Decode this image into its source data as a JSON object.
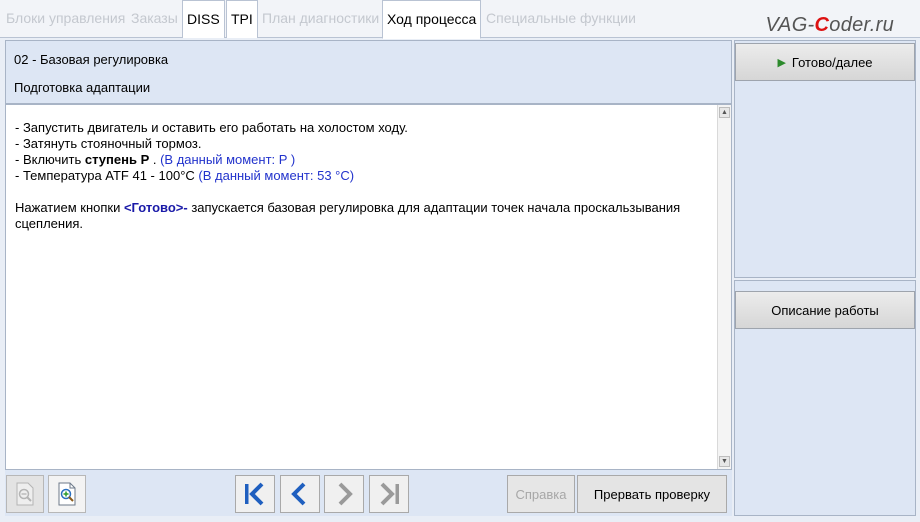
{
  "tabs": [
    {
      "label": "Блоки управления",
      "state": "disabled"
    },
    {
      "label": "Заказы",
      "state": "disabled"
    },
    {
      "label": "DISS",
      "state": "enabled"
    },
    {
      "label": "TPI",
      "state": "enabled"
    },
    {
      "label": "План диагностики",
      "state": "disabled"
    },
    {
      "label": "Ход процесса",
      "state": "active"
    },
    {
      "label": "Специальные функции",
      "state": "disabled"
    }
  ],
  "watermark": {
    "prefix": "VAG-",
    "accent": "C",
    "suffix": "oder.ru"
  },
  "header": {
    "line1": "02 - Базовая регулировка",
    "line2": "Подготовка адаптации"
  },
  "instructions": {
    "line1": "- Запустить двигатель и оставить его работать на холостом ходу.",
    "line2": "- Затянуть стояночный тормоз.",
    "line3_prefix": "- Включить ",
    "line3_bold": "ступень P",
    "line3_mid": " . ",
    "line3_live": "(В данный момент: P  )",
    "line4_prefix": "- Температура ATF 41 - 100°C ",
    "line4_live": "(В данный момент: 53  °C)",
    "para_prefix": "Нажатием кнопки ",
    "para_button": "<Готово>-",
    "para_suffix": " запускается базовая регулировка для адаптации точек начала проскальзывания сцепления."
  },
  "toolbar": {
    "help_label": "Справка",
    "abort_label": "Прервать проверку"
  },
  "right_panel": {
    "done_label": "Готово/далее",
    "description_label": "Описание работы"
  },
  "colors": {
    "accent_blue": "#2233cc",
    "nav_blue": "#1f5fbf",
    "play_green": "#2c8a2c"
  }
}
